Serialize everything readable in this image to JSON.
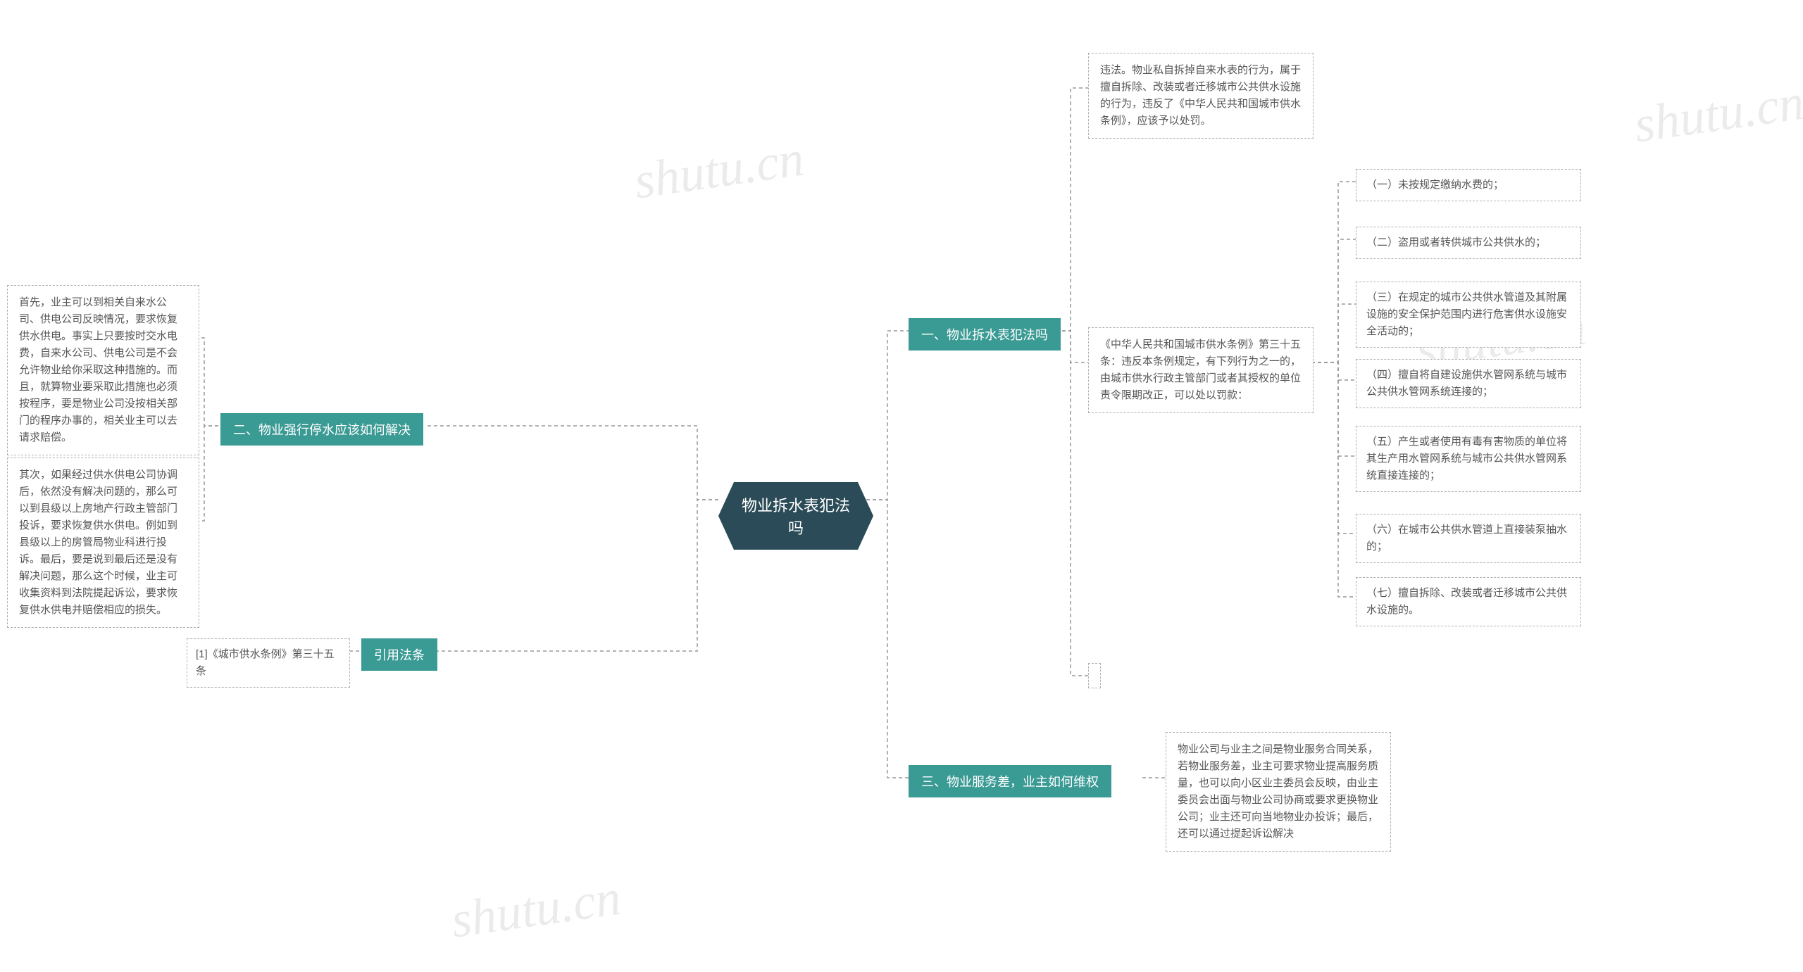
{
  "watermark": "shutu.cn",
  "root": "物业拆水表犯法吗",
  "branches": {
    "b1": "一、物业拆水表犯法吗",
    "b2": "二、物业强行停水应该如何解决",
    "b3": "三、物业服务差，业主如何维权",
    "b4": "引用法条"
  },
  "leaves": {
    "l1_1": "违法。物业私自拆掉自来水表的行为，属于擅自拆除、改装或者迁移城市公共供水设施的行为，违反了《中华人民共和国城市供水条例》，应该予以处罚。",
    "l1_2": "《中华人民共和国城市供水条例》第三十五条：违反本条例规定，有下列行为之一的，由城市供水行政主管部门或者其授权的单位责令限期改正，可以处以罚款：",
    "l1_2_1": "（一）未按规定缴纳水费的；",
    "l1_2_2": "（二）盗用或者转供城市公共供水的；",
    "l1_2_3": "（三）在规定的城市公共供水管道及其附属设施的安全保护范围内进行危害供水设施安全活动的；",
    "l1_2_4": "（四）擅自将自建设施供水管网系统与城市公共供水管网系统连接的；",
    "l1_2_5": "（五）产生或者使用有毒有害物质的单位将其生产用水管网系统与城市公共供水管网系统直接连接的；",
    "l1_2_6": "（六）在城市公共供水管道上直接装泵抽水的；",
    "l1_2_7": "（七）擅自拆除、改装或者迁移城市公共供水设施的。",
    "l2_1": "首先，业主可以到相关自来水公司、供电公司反映情况，要求恢复供水供电。事实上只要按时交水电费，自来水公司、供电公司是不会允许物业给你采取这种措施的。而且，就算物业要采取此措施也必须按程序，要是物业公司没按相关部门的程序办事的，相关业主可以去请求赔偿。",
    "l2_2": "其次，如果经过供水供电公司协调后，依然没有解决问题的，那么可以到县级以上房地产行政主管部门投诉，要求恢复供水供电。例如到县级以上的房管局物业科进行投诉。最后，要是说到最后还是没有解决问题，那么这个时候，业主可收集资料到法院提起诉讼，要求恢复供水供电并赔偿相应的损失。",
    "l3_1": "物业公司与业主之间是物业服务合同关系，若物业服务差，业主可要求物业提高服务质量，也可以向小区业主委员会反映，由业主委员会出面与物业公司协商或要求更换物业公司；业主还可向当地物业办投诉；最后，还可以通过提起诉讼解决",
    "l4_1": "[1]《城市供水条例》第三十五条"
  }
}
